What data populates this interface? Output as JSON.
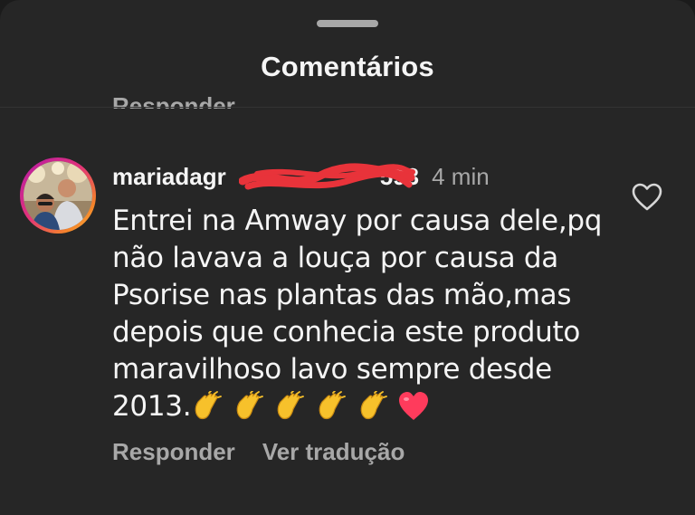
{
  "sheet": {
    "title": "Comentários"
  },
  "previous_reply": {
    "label": "Responder"
  },
  "comment": {
    "username": "mariadagr",
    "username_tail": "593",
    "time": "4 min",
    "lines": [
      "Entrei na Amway por causa dele,pq",
      "não lavava a louça por causa da",
      "Psorise nas plantas das mão,mas",
      "depois que conhecia este produto",
      "maravilhoso lavo sempre desde",
      "2013."
    ],
    "emojis": [
      "clapping-hands",
      "clapping-hands",
      "clapping-hands",
      "clapping-hands",
      "clapping-hands",
      "red-heart"
    ],
    "reply_label": "Responder",
    "translate_label": "Ver tradução"
  },
  "colors": {
    "background": "#262626",
    "primary_text": "#f5f5f5",
    "secondary_text": "#a8a8a8",
    "redaction": "#e8333a",
    "heart": "#ff3b5c",
    "clap": "#f7c12b"
  }
}
